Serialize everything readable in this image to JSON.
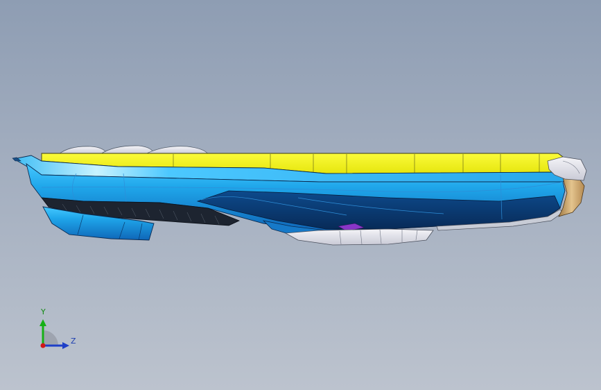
{
  "view": {
    "background_top": "#8e9db3",
    "background_bottom": "#bcc3ce"
  },
  "model": {
    "name_icon": "cad-part-icon",
    "colors": {
      "top_plate": "#f2f21a",
      "hull": "#2bb4ee",
      "hull_dark": "#0b3d7a",
      "hull_mid": "#1577c6",
      "white_parts": "#e8e8ef",
      "tan_part": "#cfa36a",
      "purple_detail": "#8a36c8"
    }
  },
  "triad": {
    "y_label": "Y",
    "z_label": "Z",
    "y_color": "#16b016",
    "z_color": "#1e3fc8",
    "x_color": "#d01818"
  }
}
